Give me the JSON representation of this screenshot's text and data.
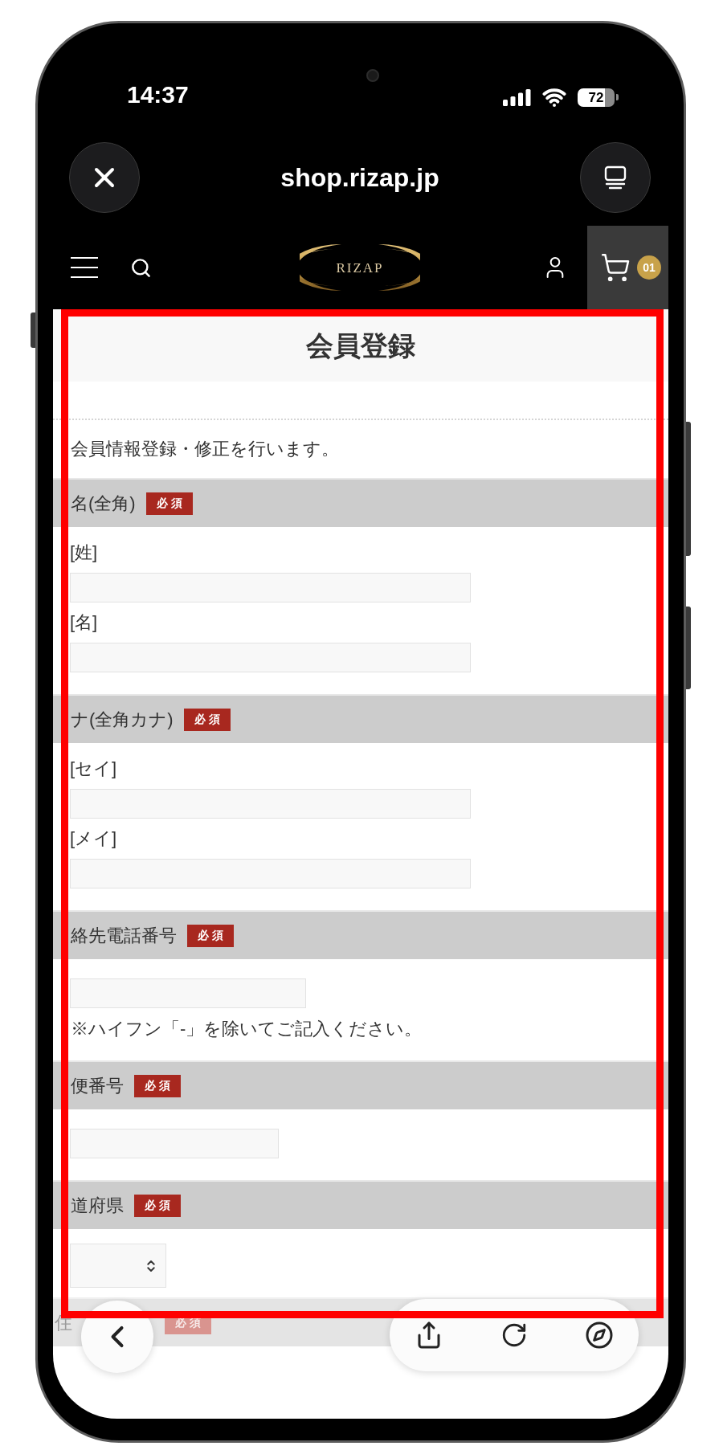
{
  "status_bar": {
    "time": "14:37",
    "battery": "72"
  },
  "browser_bar": {
    "url": "shop.rizap.jp"
  },
  "site_header": {
    "logo": "RIZAP",
    "cart_count": "01"
  },
  "page": {
    "title": "会員登録",
    "intro": "会員情報登録・修正を行います。",
    "sections": [
      {
        "label": "名(全角)",
        "badge": "必須",
        "fields": [
          {
            "kind": "long",
            "label": "[姓]"
          },
          {
            "kind": "long",
            "label": "[名]"
          }
        ]
      },
      {
        "label": "ナ(全角カナ)",
        "badge": "必須",
        "fields": [
          {
            "kind": "long",
            "label": "[セイ]"
          },
          {
            "kind": "long",
            "label": "[メイ]"
          }
        ]
      },
      {
        "label": "絡先電話番号",
        "badge": "必須",
        "fields": [
          {
            "kind": "medium"
          }
        ],
        "note": "※ハイフン「-」を除いてご記入ください。"
      },
      {
        "label": "便番号",
        "badge": "必須",
        "fields": [
          {
            "kind": "short"
          }
        ]
      },
      {
        "label": "道府県",
        "badge": "必須",
        "fields": [
          {
            "kind": "select"
          }
        ]
      }
    ],
    "partial_section": {
      "label": "住",
      "badge": "必須"
    }
  }
}
